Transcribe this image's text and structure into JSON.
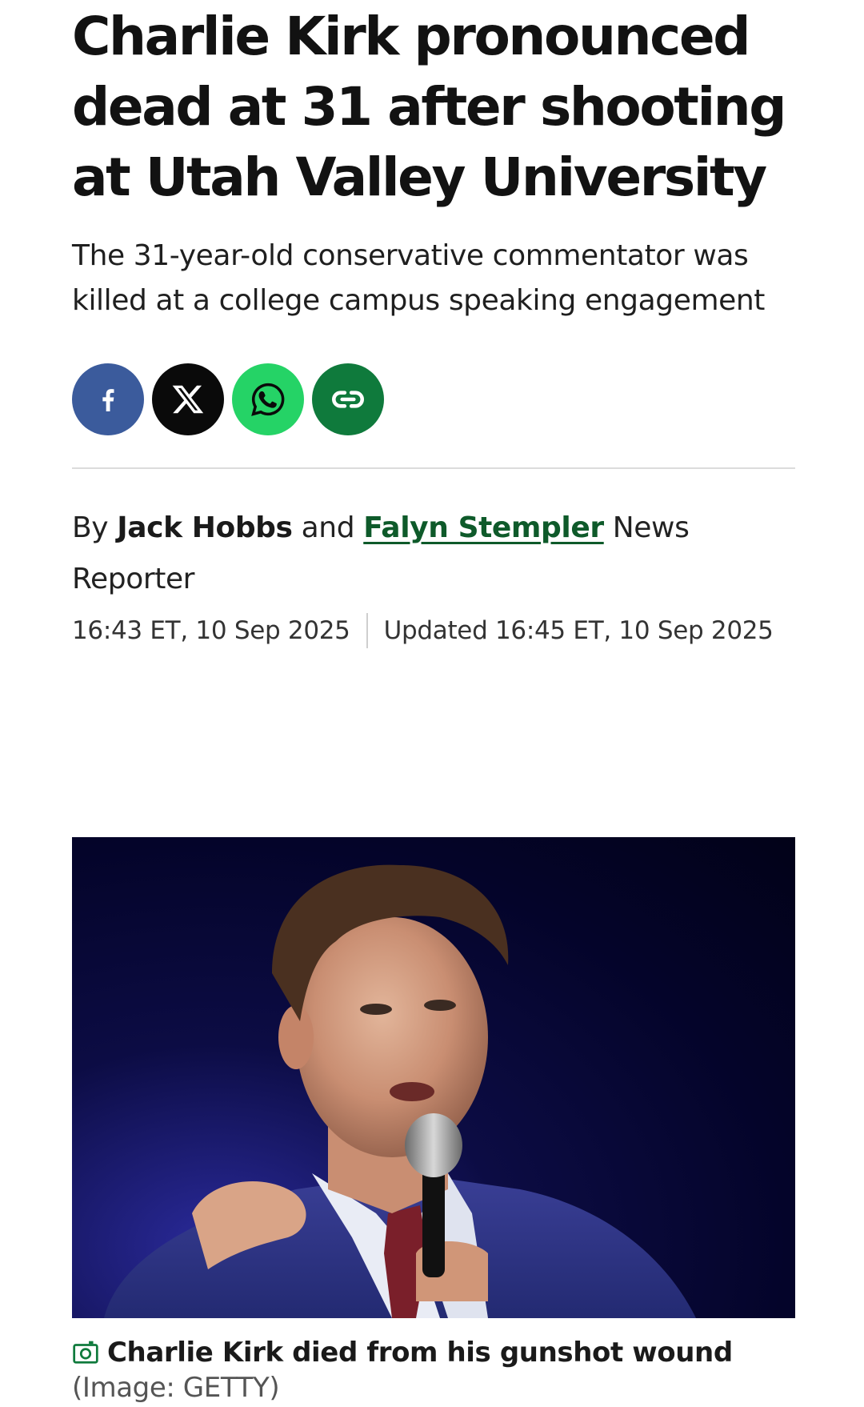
{
  "headline": "Charlie Kirk pronounced dead at 31 after shooting at Utah Valley University",
  "standfirst": "The 31-year-old conservative commentator was killed at a college campus speaking engagement",
  "share": [
    {
      "icon": "facebook-icon",
      "color": "#3b5b9c"
    },
    {
      "icon": "x-icon",
      "color": "#0a0a0a"
    },
    {
      "icon": "whatsapp-icon",
      "color": "#25d366"
    },
    {
      "icon": "link-icon",
      "color": "#0f7a3c"
    }
  ],
  "byline": {
    "by": "By",
    "author1": "Jack Hobbs",
    "and": "and",
    "author2": "Falyn Stempler",
    "role": "News Reporter"
  },
  "published": "16:43 ET, 10 Sep 2025",
  "updated": "Updated 16:45 ET, 10 Sep 2025",
  "image": {
    "caption": "Charlie Kirk died from his gunshot wound",
    "credit": "(Image: GETTY)"
  },
  "colors": {
    "author_link": "#0e5a2a",
    "image_background": "#04042a"
  }
}
